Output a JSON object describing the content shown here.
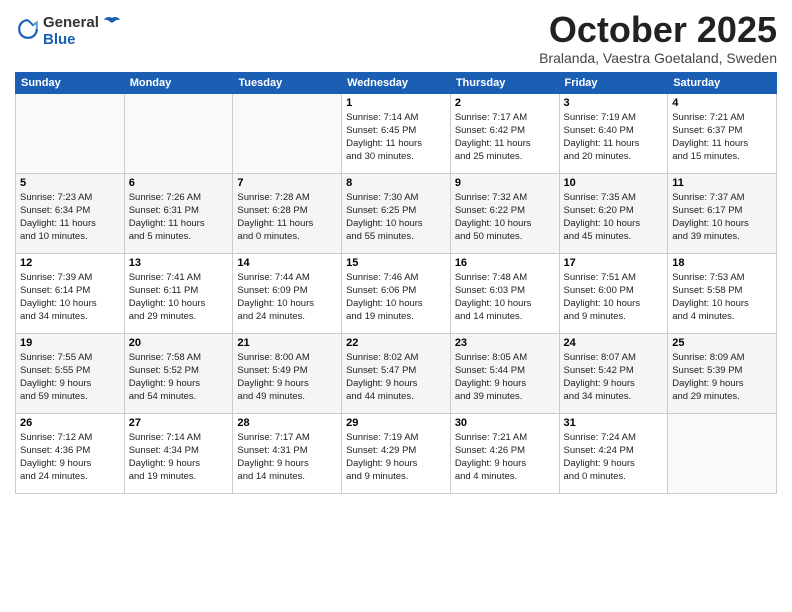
{
  "logo": {
    "general": "General",
    "blue": "Blue"
  },
  "title": "October 2025",
  "location": "Bralanda, Vaestra Goetaland, Sweden",
  "days_header": [
    "Sunday",
    "Monday",
    "Tuesday",
    "Wednesday",
    "Thursday",
    "Friday",
    "Saturday"
  ],
  "weeks": [
    [
      {
        "num": "",
        "info": ""
      },
      {
        "num": "",
        "info": ""
      },
      {
        "num": "",
        "info": ""
      },
      {
        "num": "1",
        "info": "Sunrise: 7:14 AM\nSunset: 6:45 PM\nDaylight: 11 hours\nand 30 minutes."
      },
      {
        "num": "2",
        "info": "Sunrise: 7:17 AM\nSunset: 6:42 PM\nDaylight: 11 hours\nand 25 minutes."
      },
      {
        "num": "3",
        "info": "Sunrise: 7:19 AM\nSunset: 6:40 PM\nDaylight: 11 hours\nand 20 minutes."
      },
      {
        "num": "4",
        "info": "Sunrise: 7:21 AM\nSunset: 6:37 PM\nDaylight: 11 hours\nand 15 minutes."
      }
    ],
    [
      {
        "num": "5",
        "info": "Sunrise: 7:23 AM\nSunset: 6:34 PM\nDaylight: 11 hours\nand 10 minutes."
      },
      {
        "num": "6",
        "info": "Sunrise: 7:26 AM\nSunset: 6:31 PM\nDaylight: 11 hours\nand 5 minutes."
      },
      {
        "num": "7",
        "info": "Sunrise: 7:28 AM\nSunset: 6:28 PM\nDaylight: 11 hours\nand 0 minutes."
      },
      {
        "num": "8",
        "info": "Sunrise: 7:30 AM\nSunset: 6:25 PM\nDaylight: 10 hours\nand 55 minutes."
      },
      {
        "num": "9",
        "info": "Sunrise: 7:32 AM\nSunset: 6:22 PM\nDaylight: 10 hours\nand 50 minutes."
      },
      {
        "num": "10",
        "info": "Sunrise: 7:35 AM\nSunset: 6:20 PM\nDaylight: 10 hours\nand 45 minutes."
      },
      {
        "num": "11",
        "info": "Sunrise: 7:37 AM\nSunset: 6:17 PM\nDaylight: 10 hours\nand 39 minutes."
      }
    ],
    [
      {
        "num": "12",
        "info": "Sunrise: 7:39 AM\nSunset: 6:14 PM\nDaylight: 10 hours\nand 34 minutes."
      },
      {
        "num": "13",
        "info": "Sunrise: 7:41 AM\nSunset: 6:11 PM\nDaylight: 10 hours\nand 29 minutes."
      },
      {
        "num": "14",
        "info": "Sunrise: 7:44 AM\nSunset: 6:09 PM\nDaylight: 10 hours\nand 24 minutes."
      },
      {
        "num": "15",
        "info": "Sunrise: 7:46 AM\nSunset: 6:06 PM\nDaylight: 10 hours\nand 19 minutes."
      },
      {
        "num": "16",
        "info": "Sunrise: 7:48 AM\nSunset: 6:03 PM\nDaylight: 10 hours\nand 14 minutes."
      },
      {
        "num": "17",
        "info": "Sunrise: 7:51 AM\nSunset: 6:00 PM\nDaylight: 10 hours\nand 9 minutes."
      },
      {
        "num": "18",
        "info": "Sunrise: 7:53 AM\nSunset: 5:58 PM\nDaylight: 10 hours\nand 4 minutes."
      }
    ],
    [
      {
        "num": "19",
        "info": "Sunrise: 7:55 AM\nSunset: 5:55 PM\nDaylight: 9 hours\nand 59 minutes."
      },
      {
        "num": "20",
        "info": "Sunrise: 7:58 AM\nSunset: 5:52 PM\nDaylight: 9 hours\nand 54 minutes."
      },
      {
        "num": "21",
        "info": "Sunrise: 8:00 AM\nSunset: 5:49 PM\nDaylight: 9 hours\nand 49 minutes."
      },
      {
        "num": "22",
        "info": "Sunrise: 8:02 AM\nSunset: 5:47 PM\nDaylight: 9 hours\nand 44 minutes."
      },
      {
        "num": "23",
        "info": "Sunrise: 8:05 AM\nSunset: 5:44 PM\nDaylight: 9 hours\nand 39 minutes."
      },
      {
        "num": "24",
        "info": "Sunrise: 8:07 AM\nSunset: 5:42 PM\nDaylight: 9 hours\nand 34 minutes."
      },
      {
        "num": "25",
        "info": "Sunrise: 8:09 AM\nSunset: 5:39 PM\nDaylight: 9 hours\nand 29 minutes."
      }
    ],
    [
      {
        "num": "26",
        "info": "Sunrise: 7:12 AM\nSunset: 4:36 PM\nDaylight: 9 hours\nand 24 minutes."
      },
      {
        "num": "27",
        "info": "Sunrise: 7:14 AM\nSunset: 4:34 PM\nDaylight: 9 hours\nand 19 minutes."
      },
      {
        "num": "28",
        "info": "Sunrise: 7:17 AM\nSunset: 4:31 PM\nDaylight: 9 hours\nand 14 minutes."
      },
      {
        "num": "29",
        "info": "Sunrise: 7:19 AM\nSunset: 4:29 PM\nDaylight: 9 hours\nand 9 minutes."
      },
      {
        "num": "30",
        "info": "Sunrise: 7:21 AM\nSunset: 4:26 PM\nDaylight: 9 hours\nand 4 minutes."
      },
      {
        "num": "31",
        "info": "Sunrise: 7:24 AM\nSunset: 4:24 PM\nDaylight: 9 hours\nand 0 minutes."
      },
      {
        "num": "",
        "info": ""
      }
    ]
  ]
}
